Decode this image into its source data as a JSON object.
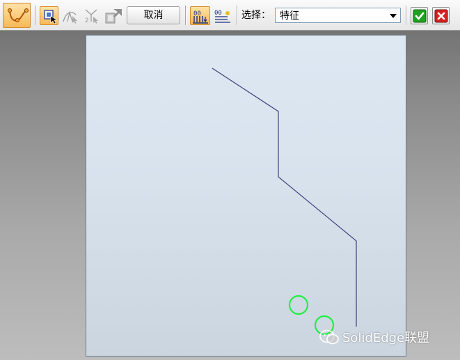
{
  "toolbar": {
    "cancel_label": "取消",
    "select_label": "选择：",
    "select_value": "特征"
  },
  "watermark": {
    "text": "SolidEdge联盟"
  },
  "colors": {
    "path_line": "#3b3f78",
    "highlight_circle": "#22ee44",
    "active_button": "#f6b955",
    "ok_green": "#1e9a1e",
    "close_red": "#d21c1c"
  },
  "icons": [
    "path-curve-icon",
    "select-face-icon",
    "tangent-icon",
    "step-icon",
    "reorder-icon",
    "order-numbers-icon",
    "list-numbers-icon",
    "check-icon",
    "close-icon",
    "wechat-icon"
  ]
}
